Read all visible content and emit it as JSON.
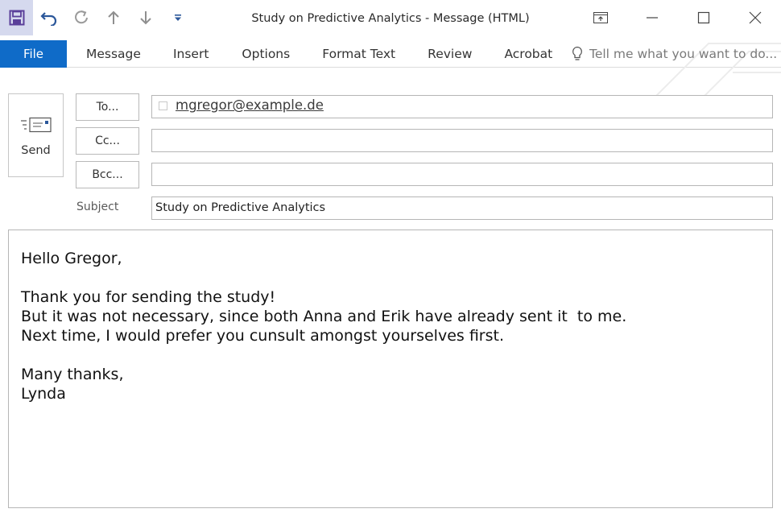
{
  "window": {
    "title": "Study on Predictive Analytics - Message (HTML)"
  },
  "quick_access": [
    {
      "icon": "save-icon"
    },
    {
      "icon": "undo-icon"
    },
    {
      "icon": "redo-icon"
    },
    {
      "icon": "up-arrow-icon"
    },
    {
      "icon": "down-arrow-icon"
    },
    {
      "icon": "customize-icon"
    }
  ],
  "ribbon": {
    "file_label": "File",
    "tabs": [
      "Message",
      "Insert",
      "Options",
      "Format Text",
      "Review",
      "Acrobat"
    ],
    "tell_me_placeholder": "Tell me what you want to do..."
  },
  "compose": {
    "send_label": "Send",
    "to_label": "To...",
    "cc_label": "Cc...",
    "bcc_label": "Bcc...",
    "to_recipient": "mgregor@example.de",
    "cc_value": "",
    "bcc_value": "",
    "subject_label": "Subject",
    "subject_value": "Study on Predictive Analytics"
  },
  "message_body": {
    "lines": [
      "Hello Gregor,",
      "",
      "Thank you for sending the study!",
      "But it was not necessary, since both Anna and Erik have already sent it  to me.",
      "Next time, I would prefer you cunsult amongst yourselves first.",
      "",
      "Many thanks,",
      "Lynda"
    ]
  },
  "colors": {
    "file_tab": "#0f6bc8",
    "save_highlight": "#d5d9ee",
    "accent_icon": "#2b579a"
  }
}
